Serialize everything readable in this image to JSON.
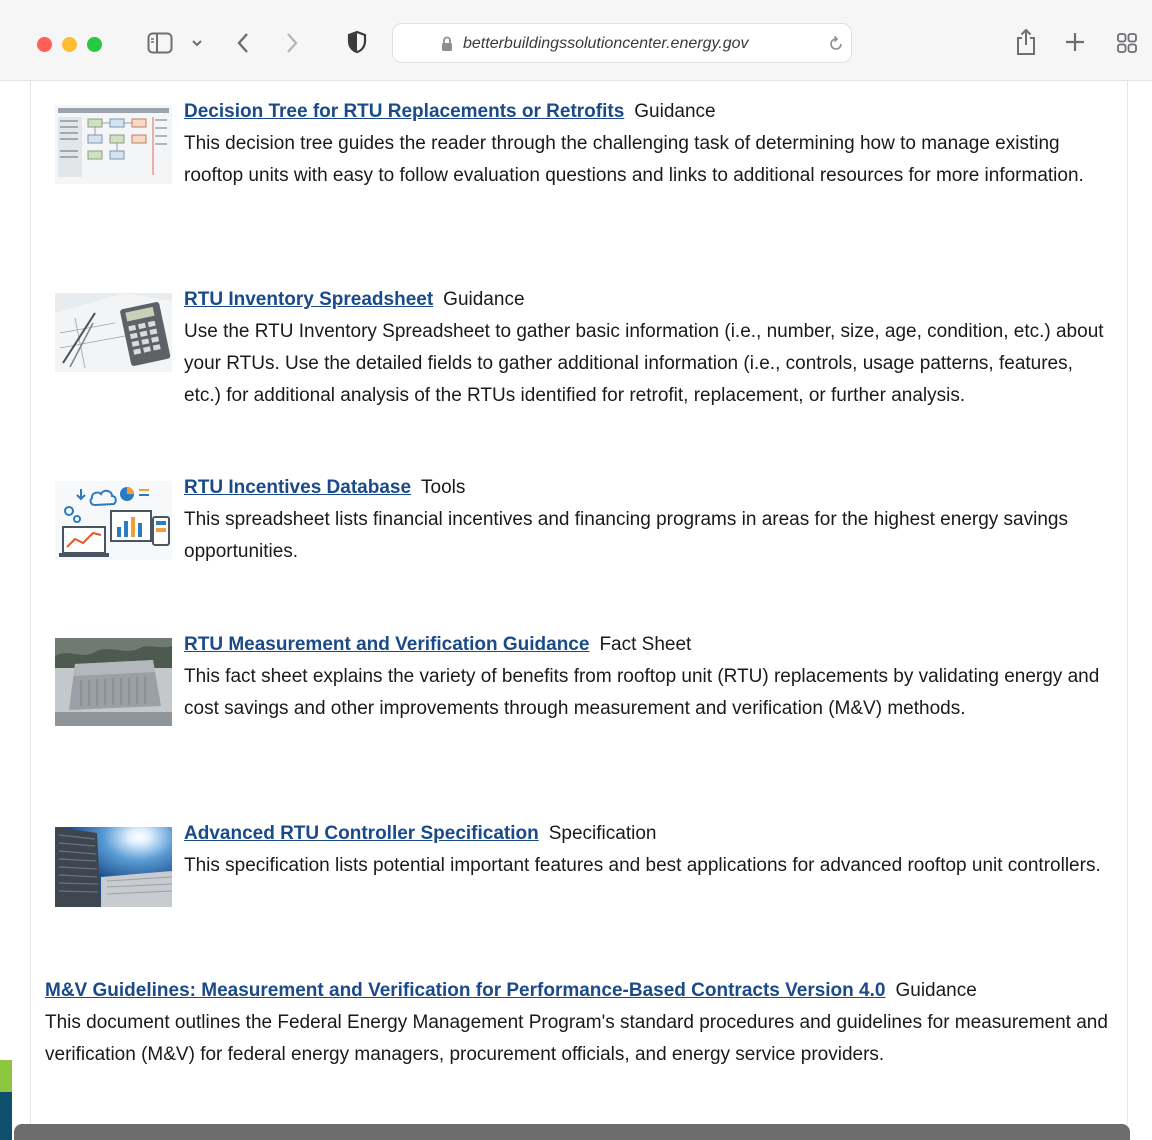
{
  "browser": {
    "url": "betterbuildingssolutioncenter.energy.gov",
    "icons": [
      "sidebar-icon",
      "chevron-down-icon",
      "back-icon",
      "forward-icon",
      "shield-icon",
      "lock-icon",
      "reload-icon",
      "share-icon",
      "plus-icon",
      "tab-overview-icon"
    ]
  },
  "resources": [
    {
      "title": "Decision Tree for RTU Replacements or Retrofits",
      "type": "Guidance",
      "description": "This decision tree guides the reader through the challenging task of determining how to manage existing rooftop units with easy to follow evaluation questions and links to additional resources for more information.",
      "thumbnail": "flowchart-thumbnail"
    },
    {
      "title": "RTU Inventory Spreadsheet",
      "type": "Guidance",
      "description": "Use the RTU Inventory Spreadsheet to gather basic information (i.e., number, size, age, condition, etc.) about your RTUs. Use the detailed fields to gather additional information (i.e., controls, usage patterns, features, etc.) for additional analysis of the RTUs identified for retrofit, replacement, or further analysis.",
      "thumbnail": "calculator-blueprint-thumbnail"
    },
    {
      "title": "RTU Incentives Database",
      "type": "Tools",
      "description": "This spreadsheet lists financial incentives and financing programs in areas for the highest energy savings opportunities.",
      "thumbnail": "devices-cloud-thumbnail"
    },
    {
      "title": "RTU Measurement and Verification Guidance",
      "type": "Fact Sheet",
      "description": "This fact sheet explains the variety of benefits from rooftop unit (RTU) replacements by validating energy and cost savings and other improvements through measurement and verification (M&V) methods.",
      "thumbnail": "rooftop-unit-thumbnail"
    },
    {
      "title": "Advanced RTU Controller Specification",
      "type": "Specification",
      "description": "This specification lists potential important features and best applications for advanced rooftop unit controllers.",
      "thumbnail": "rooftop-fans-sky-thumbnail"
    },
    {
      "title": "M&V Guidelines: Measurement and Verification for Performance-Based Contracts Version 4.0",
      "type": "Guidance",
      "description": "This document outlines the Federal Energy Management Program's standard procedures and guidelines for measurement and verification (M&V) for federal energy managers, procurement officials, and energy service providers."
    }
  ],
  "colors": {
    "link": "#1a4a8a",
    "text": "#1a1a1a",
    "toolbar_bg": "#f6f6f6",
    "traffic_red": "#fe5f57",
    "traffic_yellow": "#febc2e",
    "traffic_green": "#28c840"
  }
}
